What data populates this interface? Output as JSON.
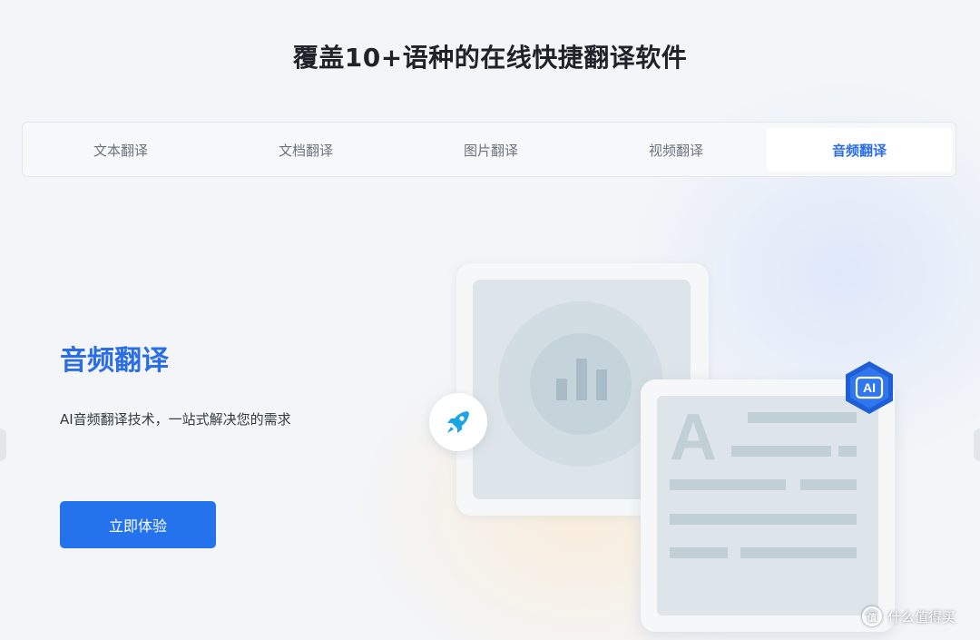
{
  "page_title": "覆盖10+语种的在线快捷翻译软件",
  "tabs": [
    {
      "label": "文本翻译",
      "active": false
    },
    {
      "label": "文档翻译",
      "active": false
    },
    {
      "label": "图片翻译",
      "active": false
    },
    {
      "label": "视频翻译",
      "active": false
    },
    {
      "label": "音频翻译",
      "active": true
    }
  ],
  "hero": {
    "title": "音频翻译",
    "description": "AI音频翻译技术，一站式解决您的需求",
    "cta_label": "立即体验"
  },
  "illustration": {
    "ai_badge_text": "AI",
    "doc_letter": "A",
    "audio_icon": "audio-bars-icon",
    "rocket_icon": "rocket-icon"
  },
  "watermark": {
    "icon_text": "值",
    "text": "什么值得买"
  },
  "colors": {
    "accent": "#2b6de5",
    "button": "#2573ec",
    "badge": "#1f5fd6"
  }
}
